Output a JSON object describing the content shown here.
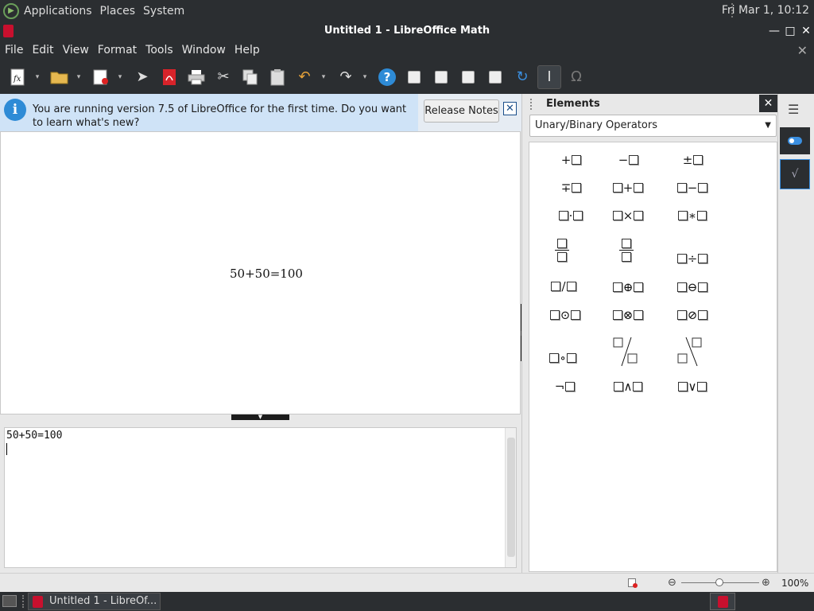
{
  "top_panel": {
    "menus": [
      "Applications",
      "Places",
      "System"
    ],
    "clock": "Fri Mar  1, 10:12"
  },
  "window": {
    "title": "Untitled 1 - LibreOffice Math",
    "controls": {
      "minimize": "—",
      "maximize": "□",
      "close": "✕"
    }
  },
  "menubar": {
    "items": [
      "File",
      "Edit",
      "View",
      "Format",
      "Tools",
      "Window",
      "Help"
    ],
    "close_doc": "✕"
  },
  "toolbar": {
    "buttons": [
      "new-formula-icon",
      "open-icon",
      "save-icon",
      "send-icon",
      "export-pdf-icon",
      "print-icon",
      "cut-icon",
      "copy-icon",
      "paste-icon",
      "undo-icon",
      "redo-icon",
      "help-icon",
      "zoom-in-icon",
      "zoom-out-icon",
      "show-all-icon",
      "zoom-fit-icon",
      "update-icon",
      "formula-cursor-icon",
      "symbols-icon"
    ],
    "glyphs": {
      "help": "?",
      "undo": "↶",
      "redo": "↷",
      "update": "↻",
      "cursor": "I",
      "symbols": "Ω",
      "cut": "✂",
      "send": "➤",
      "dropdown": "▾"
    }
  },
  "infobar": {
    "icon_glyph": "i",
    "message": "You are running version 7.5 of LibreOffice for the first time. Do you want to learn what's new?",
    "button_label": "Release Notes",
    "close_glyph": "✕"
  },
  "preview": {
    "formula": "50+50=100"
  },
  "editor": {
    "command_text": "50+50=100"
  },
  "sidebar": {
    "title": "Elements",
    "close_glyph": "✕",
    "category_selected": "Unary/Binary Operators",
    "operators": {
      "plus": "+",
      "minus": "−",
      "plusminus": "±",
      "minusplus": "∓",
      "dot": "·",
      "times": "×",
      "ast": "∗",
      "div": "÷",
      "slash": "/",
      "oplus": "⊕",
      "ominus": "⊖",
      "odot": "⊙",
      "otimes": "⊗",
      "oslash": "⊘",
      "circ": "∘",
      "neg": "¬",
      "and": "∧",
      "or": "∨"
    }
  },
  "deck": {
    "menu_glyph": "☰"
  },
  "statusbar": {
    "zoom_out_glyph": "⊖",
    "zoom_in_glyph": "⊕",
    "zoom_value": "100%",
    "zoom_level": 1.0
  },
  "taskbar": {
    "task_label": "Untitled 1 - LibreOf..."
  },
  "colors": {
    "dark_chrome": "#2b2e31",
    "accent_blue": "#3b8fe0",
    "info_bg": "#cfe3f7",
    "brand_red": "#c8102e"
  }
}
